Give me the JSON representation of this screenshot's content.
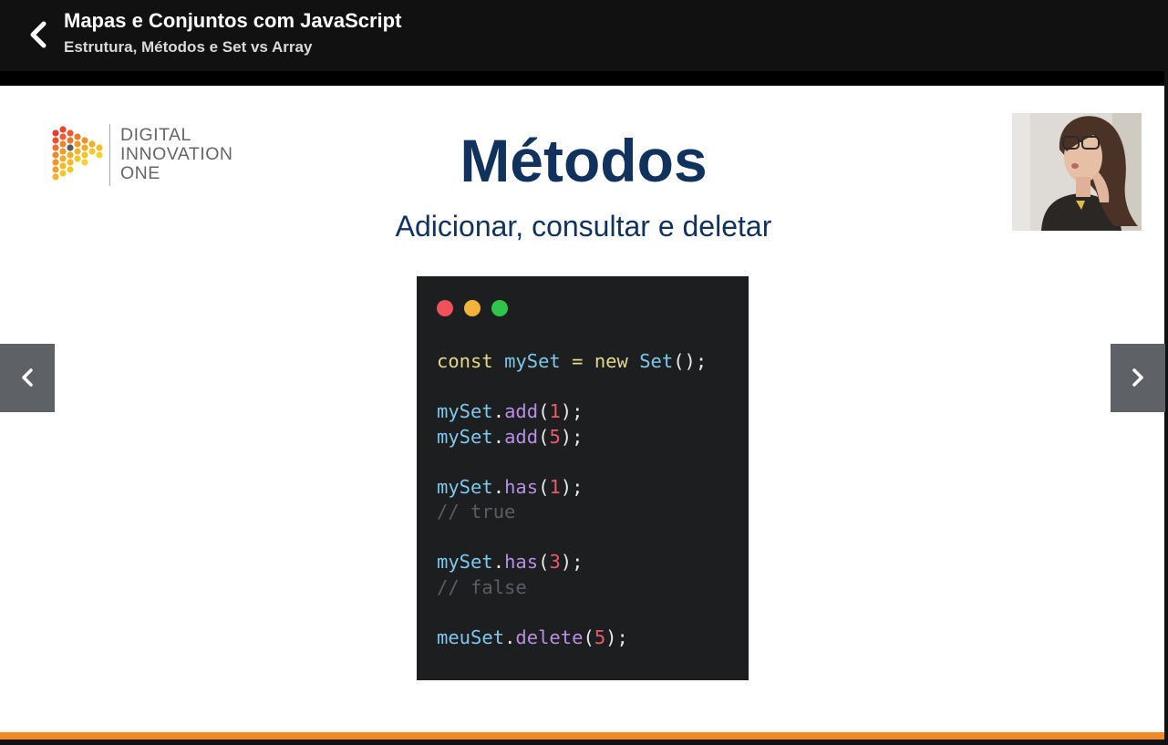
{
  "header": {
    "title": "Mapas e Conjuntos com JavaScript",
    "subtitle": "Estrutura, Métodos e Set vs Array"
  },
  "slide": {
    "logo_lines": [
      "DIGITAL",
      "INNOVATION",
      "ONE"
    ],
    "heading": "Métodos",
    "subheading": "Adicionar, consultar e deletar",
    "code": {
      "line1": {
        "kw1": "const",
        "var": "mySet",
        "eq": " = ",
        "kw2": "new",
        "cls": "Set",
        "end": "();"
      },
      "line2": {
        "obj": "mySet",
        "method": "add",
        "arg": "1"
      },
      "line3": {
        "obj": "mySet",
        "method": "add",
        "arg": "5"
      },
      "line4": {
        "obj": "mySet",
        "method": "has",
        "arg": "1"
      },
      "comment1": "// true",
      "line5": {
        "obj": "mySet",
        "method": "has",
        "arg": "3"
      },
      "comment2": "// false",
      "line6": {
        "obj": "meuSet",
        "method": "delete",
        "arg": "5"
      }
    }
  },
  "icons": {
    "back": "chevron-left-icon",
    "prev": "chevron-left-icon",
    "next": "chevron-right-icon"
  },
  "colors": {
    "accent_orange": "#f08a24",
    "heading_navy": "#12325e",
    "code_bg": "#1d1e20"
  }
}
